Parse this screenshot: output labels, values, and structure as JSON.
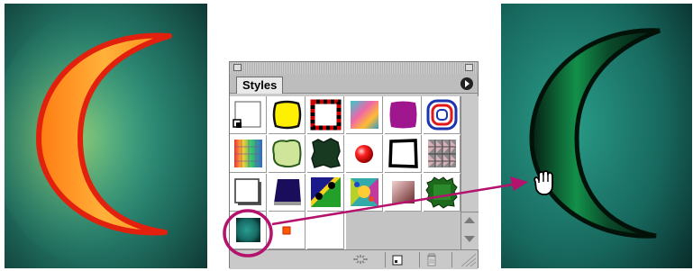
{
  "palette": {
    "tab_label": "Styles",
    "menu_button_icon": "palette-menu-arrow-icon",
    "swatches": [
      {
        "name": "default-style"
      },
      {
        "name": "yellow-rough"
      },
      {
        "name": "red-black-checker-border"
      },
      {
        "name": "rainbow-blur"
      },
      {
        "name": "purple-rough"
      },
      {
        "name": "red-blue-concentric"
      },
      {
        "name": "rainbow-grid"
      },
      {
        "name": "light-green-blob"
      },
      {
        "name": "dark-green-blob"
      },
      {
        "name": "red-sphere"
      },
      {
        "name": "black-border-square"
      },
      {
        "name": "pyramid-pattern"
      },
      {
        "name": "white-shadow-square"
      },
      {
        "name": "dark-blue-frame"
      },
      {
        "name": "dots-on-green"
      },
      {
        "name": "multicolor-mosaic"
      },
      {
        "name": "rose-bevel"
      },
      {
        "name": "green-starburst"
      },
      {
        "name": "teal-gradient-glow"
      },
      {
        "name": "small-orange-square"
      }
    ],
    "bottom_buttons": [
      "break-link-icon",
      "new-style-icon",
      "trash-icon"
    ]
  },
  "colors": {
    "teal_dark": "#0a2e2a",
    "teal_light": "#2a9c86",
    "moon_orange": "#ff8c1a",
    "moon_red": "#e02010",
    "moon_green": "#0f6b3c",
    "annotation": "#b4126c"
  },
  "icons": {
    "cursor": "grab-hand-icon",
    "arrow": "drag-arrow-icon"
  }
}
